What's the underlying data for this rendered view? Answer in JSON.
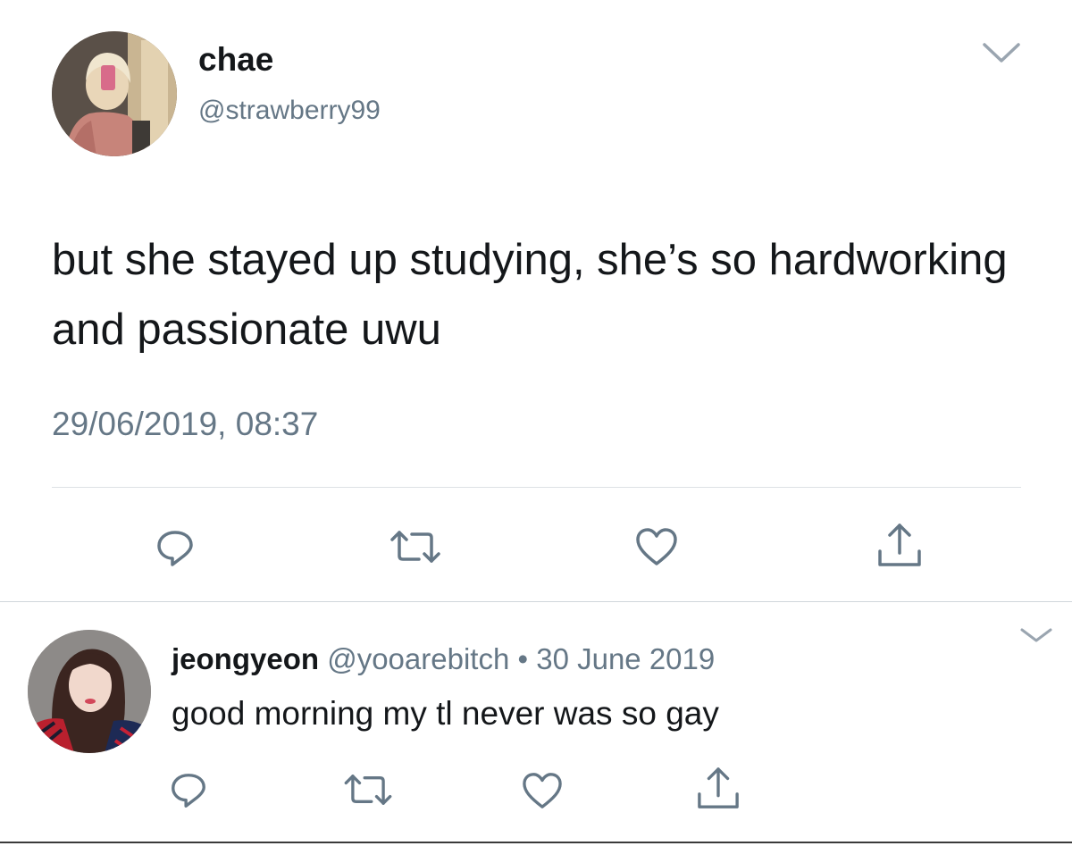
{
  "main_tweet": {
    "display_name": "chae",
    "handle": "@strawberry99",
    "text": "but she stayed up studying, she’s so hardworking and passionate uwu",
    "timestamp": "29/06/2019, 08:37",
    "icons": [
      "chevron-down-icon",
      "reply-icon",
      "retweet-icon",
      "like-icon",
      "share-icon"
    ]
  },
  "reply_tweet": {
    "display_name": "jeongyeon",
    "handle": "@yooarebitch",
    "separator": "•",
    "date": "30 June 2019",
    "text": "good morning my tl never was so gay",
    "icons": [
      "chevron-down-icon",
      "reply-icon",
      "retweet-icon",
      "like-icon",
      "share-icon"
    ]
  },
  "colors": {
    "text_primary": "#14171a",
    "text_secondary": "#657786",
    "icon_gray": "#657786",
    "divider": "#dde1e5"
  }
}
